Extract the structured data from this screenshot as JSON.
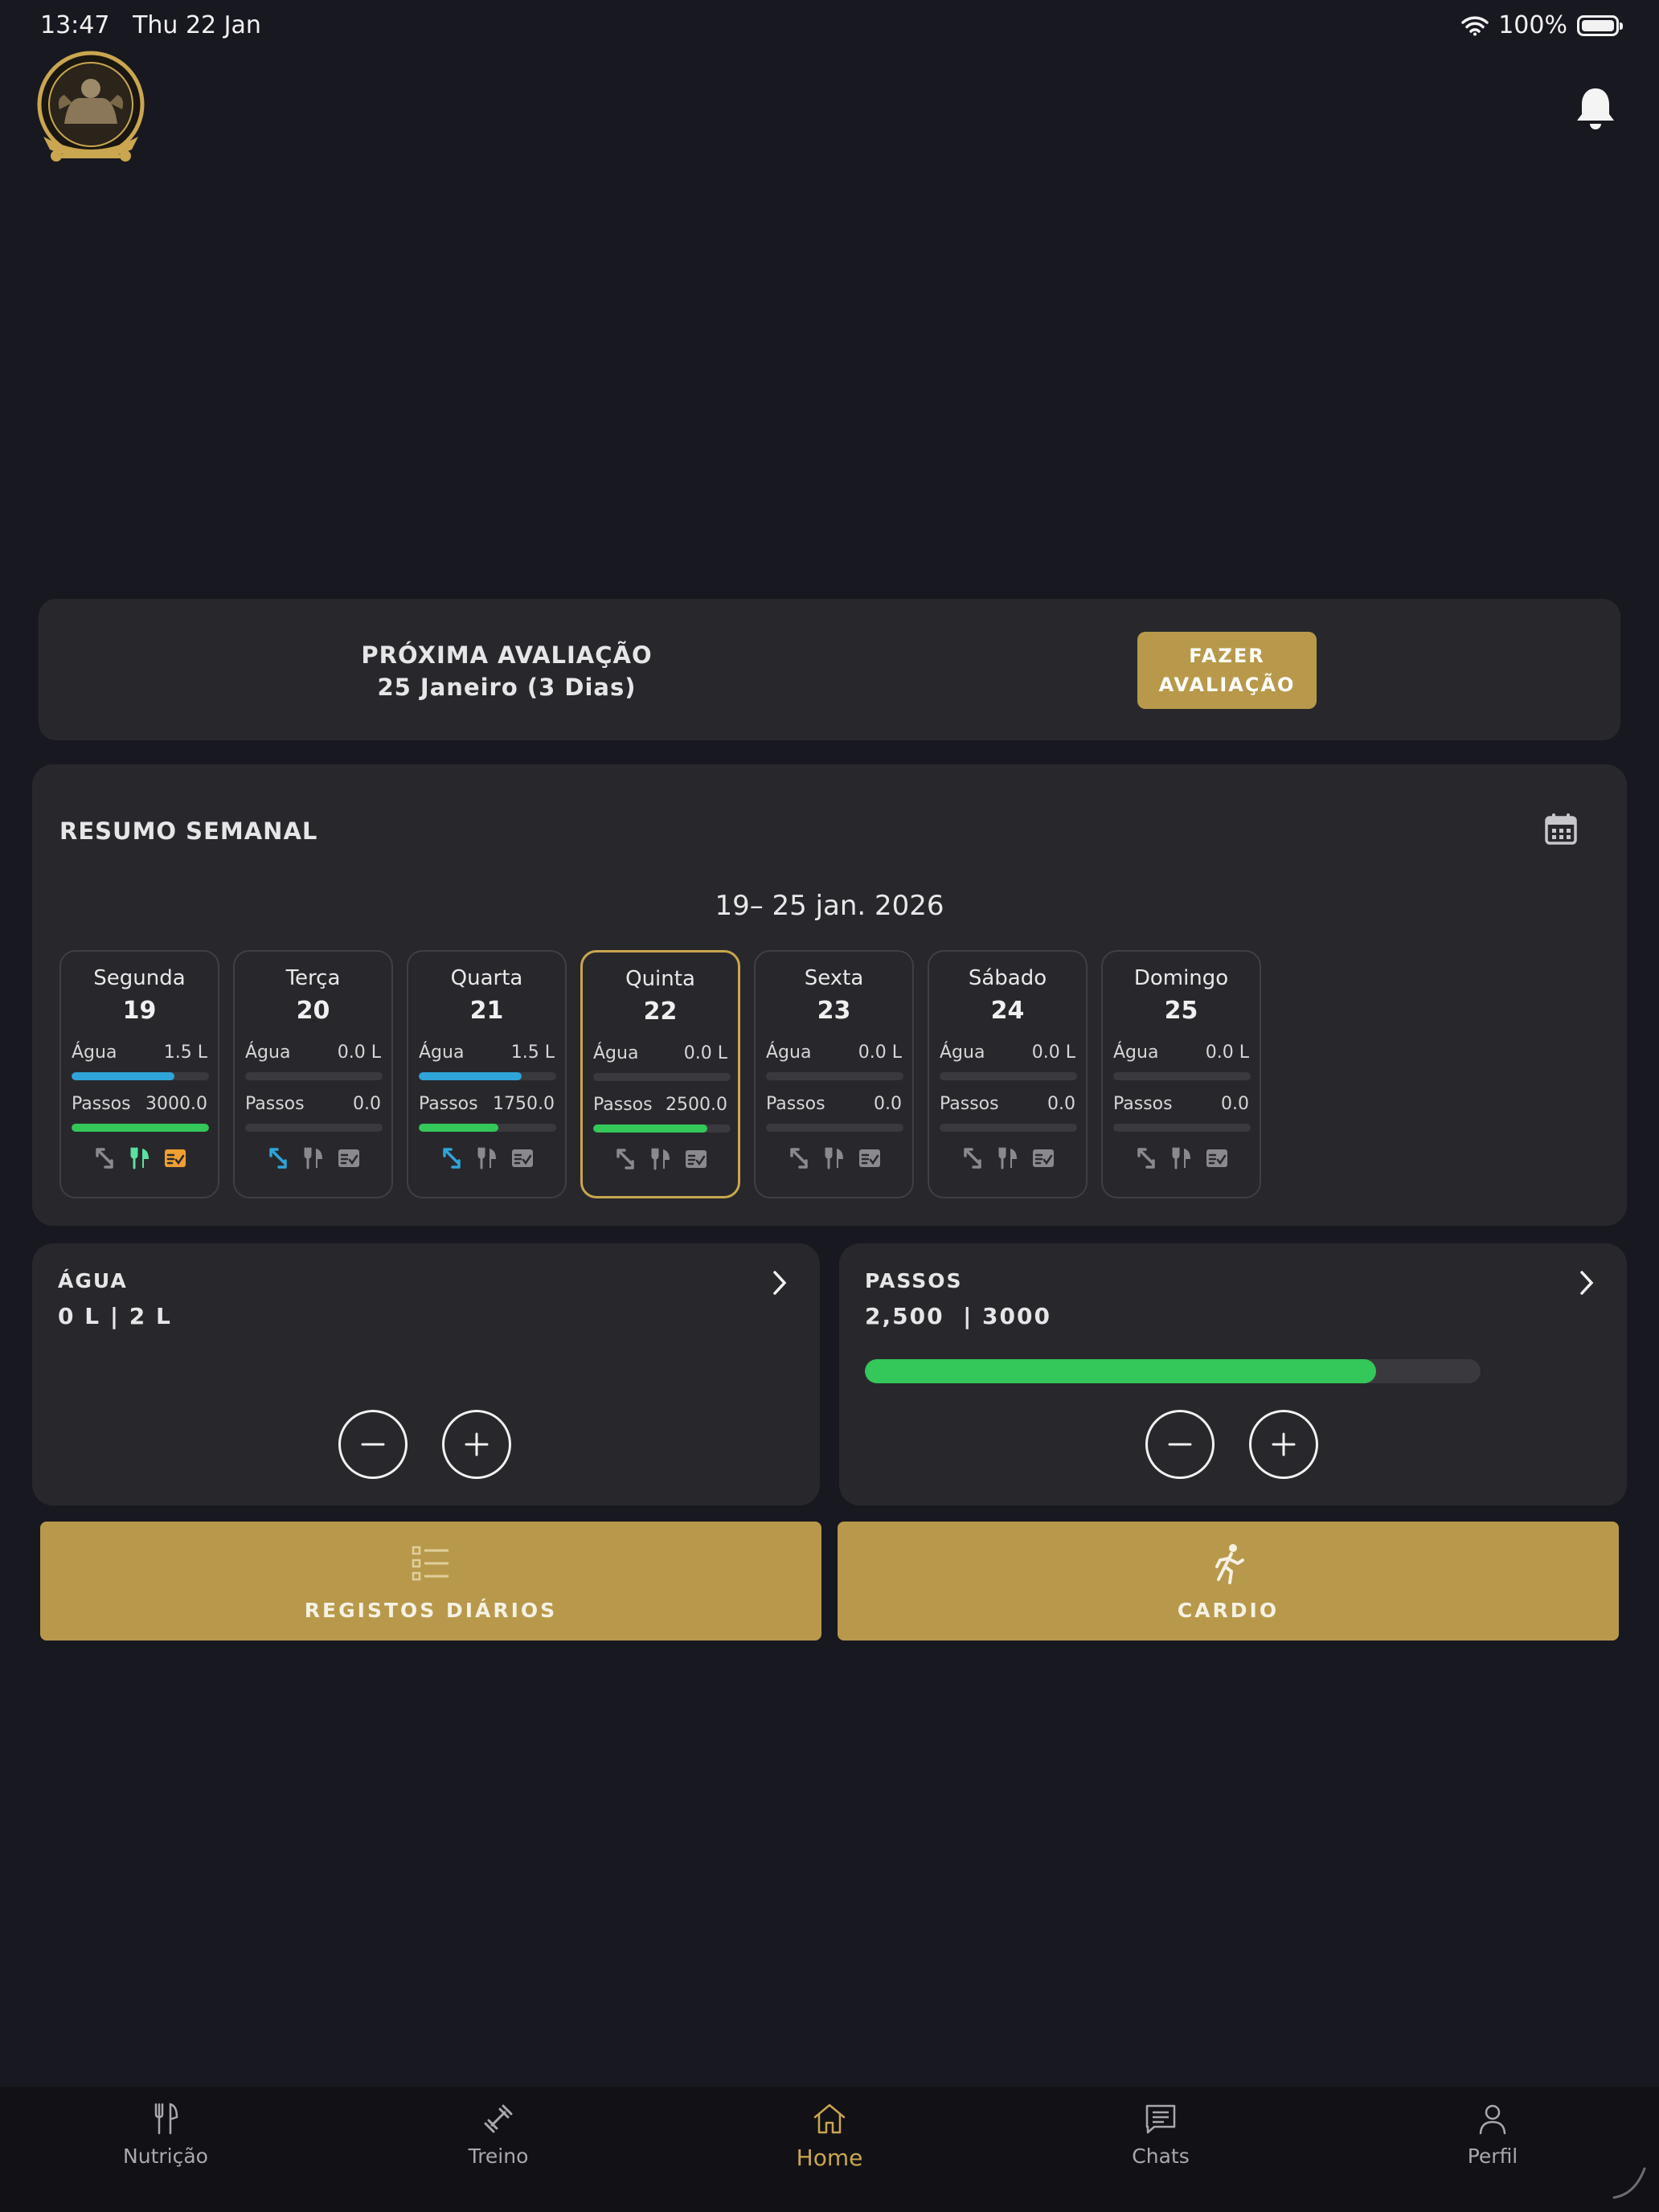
{
  "status": {
    "time": "13:47",
    "date": "Thu 22 Jan",
    "battery": "100%"
  },
  "colors": {
    "accent": "#b8994b",
    "water": "#2fa4d9",
    "steps": "#34c75a",
    "orange": "#f0a030",
    "mint": "#5be0a0"
  },
  "evaluation": {
    "title": "PRÓXIMA AVALIAÇÃO",
    "date": "25 Janeiro (3 Dias)",
    "button_line1": "FAZER",
    "button_line2": "AVALIAÇÃO"
  },
  "weekly": {
    "title": "RESUMO SEMANAL",
    "range": "19– 25 jan. 2026",
    "water_label": "Água",
    "steps_label": "Passos",
    "days": [
      {
        "name": "Segunda",
        "num": "19",
        "water": "1.5 L",
        "water_pct": 75,
        "steps": "3000.0",
        "steps_pct": 100,
        "icon_colors": [
          "#8a8a8e",
          "#5be0a0",
          "#f0a030"
        ]
      },
      {
        "name": "Terça",
        "num": "20",
        "water": "0.0 L",
        "water_pct": 0,
        "steps": "0.0",
        "steps_pct": 0,
        "icon_colors": [
          "#2fa4d9",
          "#8a8a8e",
          "#8a8a8e"
        ]
      },
      {
        "name": "Quarta",
        "num": "21",
        "water": "1.5 L",
        "water_pct": 75,
        "steps": "1750.0",
        "steps_pct": 58,
        "icon_colors": [
          "#2fa4d9",
          "#8a8a8e",
          "#8a8a8e"
        ]
      },
      {
        "name": "Quinta",
        "num": "22",
        "water": "0.0 L",
        "water_pct": 0,
        "steps": "2500.0",
        "steps_pct": 83,
        "icon_colors": [
          "#8a8a8e",
          "#8a8a8e",
          "#8a8a8e"
        ]
      },
      {
        "name": "Sexta",
        "num": "23",
        "water": "0.0 L",
        "water_pct": 0,
        "steps": "0.0",
        "steps_pct": 0,
        "icon_colors": [
          "#8a8a8e",
          "#8a8a8e",
          "#8a8a8e"
        ]
      },
      {
        "name": "Sábado",
        "num": "24",
        "water": "0.0 L",
        "water_pct": 0,
        "steps": "0.0",
        "steps_pct": 0,
        "icon_colors": [
          "#8a8a8e",
          "#8a8a8e",
          "#8a8a8e"
        ]
      },
      {
        "name": "Domingo",
        "num": "25",
        "water": "0.0 L",
        "water_pct": 0,
        "steps": "0.0",
        "steps_pct": 0,
        "icon_colors": [
          "#8a8a8e",
          "#8a8a8e",
          "#8a8a8e"
        ]
      }
    ]
  },
  "water_card": {
    "title": "ÁGUA",
    "value": "0 L | 2 L"
  },
  "steps_card": {
    "title": "PASSOS",
    "value": "2,500  | 3000",
    "progress_pct": 83
  },
  "actions": {
    "logs": "REGISTOS DIÁRIOS",
    "cardio": "CARDIO"
  },
  "tabs": [
    {
      "label": "Nutrição",
      "icon": "fork-knife-icon"
    },
    {
      "label": "Treino",
      "icon": "dumbbell-icon"
    },
    {
      "label": "Home",
      "icon": "home-icon"
    },
    {
      "label": "Chats",
      "icon": "chat-icon"
    },
    {
      "label": "Perfil",
      "icon": "person-icon"
    }
  ]
}
